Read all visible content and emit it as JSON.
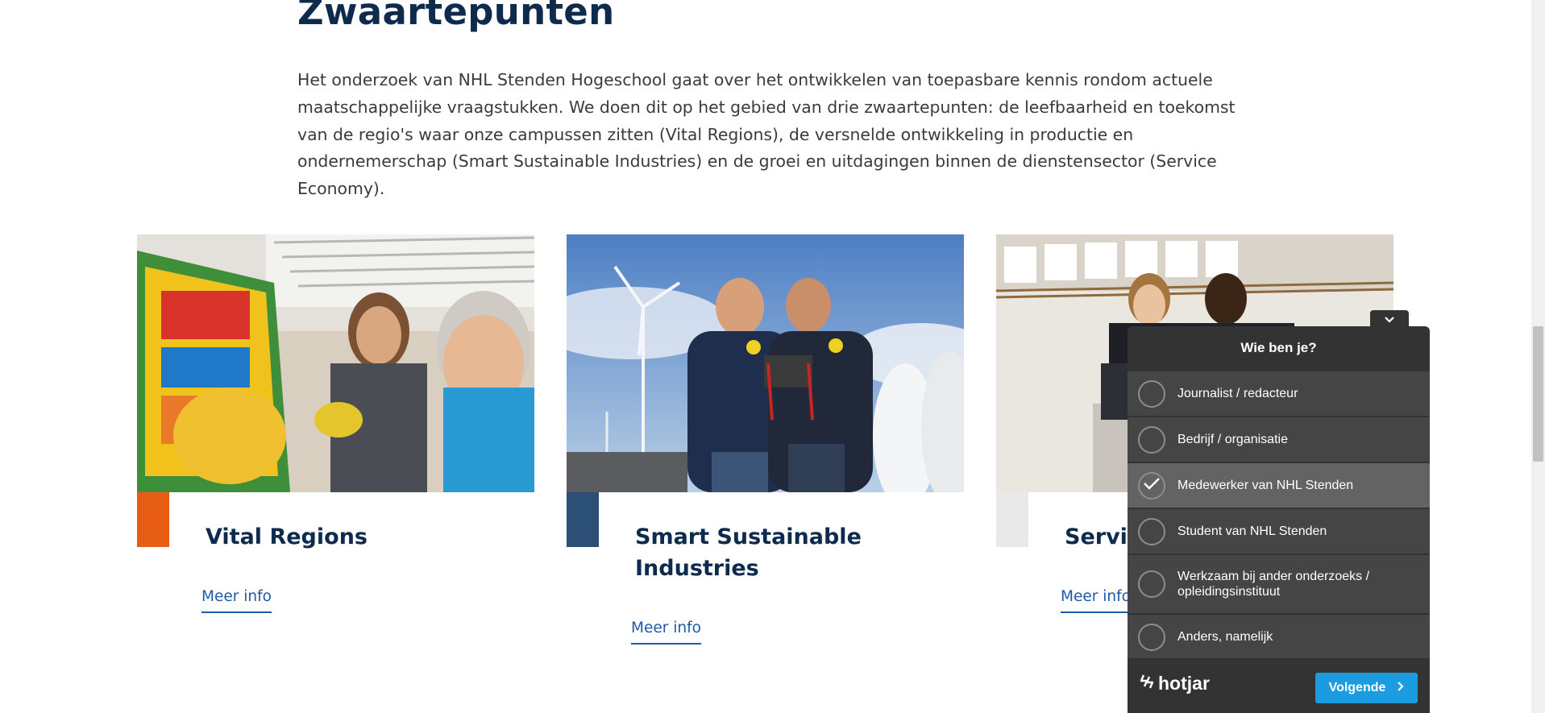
{
  "section": {
    "heading": "Zwaartepunten",
    "intro": "Het onderzoek van NHL Stenden Hogeschool gaat over het ontwikkelen van toepasbare kennis rondom actuele maatschappelijke vraagstukken. We doen dit op het gebied van drie zwaartepunten: de leefbaarheid en toekomst van de regio's waar onze campussen zitten (Vital Regions), de versnelde ontwikkeling in productie en ondernemerschap (Smart Sustainable Industries) en de groei en uitdagingen binnen de dienstensector (Service Economy)."
  },
  "cards": [
    {
      "title": "Vital Regions",
      "link": "Meer info",
      "accent": "#e85d16"
    },
    {
      "title": "Smart Sustainable Industries",
      "link": "Meer info",
      "accent": "#2c4f78"
    },
    {
      "title": "Servic",
      "link": "Meer info",
      "accent": "#e9e9e9"
    }
  ],
  "survey": {
    "question": "Wie ben je?",
    "options": [
      {
        "label": "Journalist / redacteur",
        "selected": false
      },
      {
        "label": "Bedrijf / organisatie",
        "selected": false
      },
      {
        "label": "Medewerker van NHL Stenden",
        "selected": true
      },
      {
        "label": "Student van NHL Stenden",
        "selected": false
      },
      {
        "label": "Werkzaam bij ander onderzoeks / opleidingsinstituut",
        "selected": false
      },
      {
        "label": "Anders, namelijk",
        "selected": false
      }
    ],
    "brand": "hotjar",
    "next_label": "Volgende"
  },
  "icons": {
    "collapse": "chevron-down-icon",
    "next": "chevron-right-icon",
    "check": "check-icon",
    "brand": "hotjar-logo-icon"
  },
  "colors": {
    "heading": "#0e2a4d",
    "link": "#1d5aa8",
    "widget_bg": "#333333",
    "widget_option": "#454545",
    "widget_selected": "#636363",
    "next_button": "#1b9be0"
  }
}
